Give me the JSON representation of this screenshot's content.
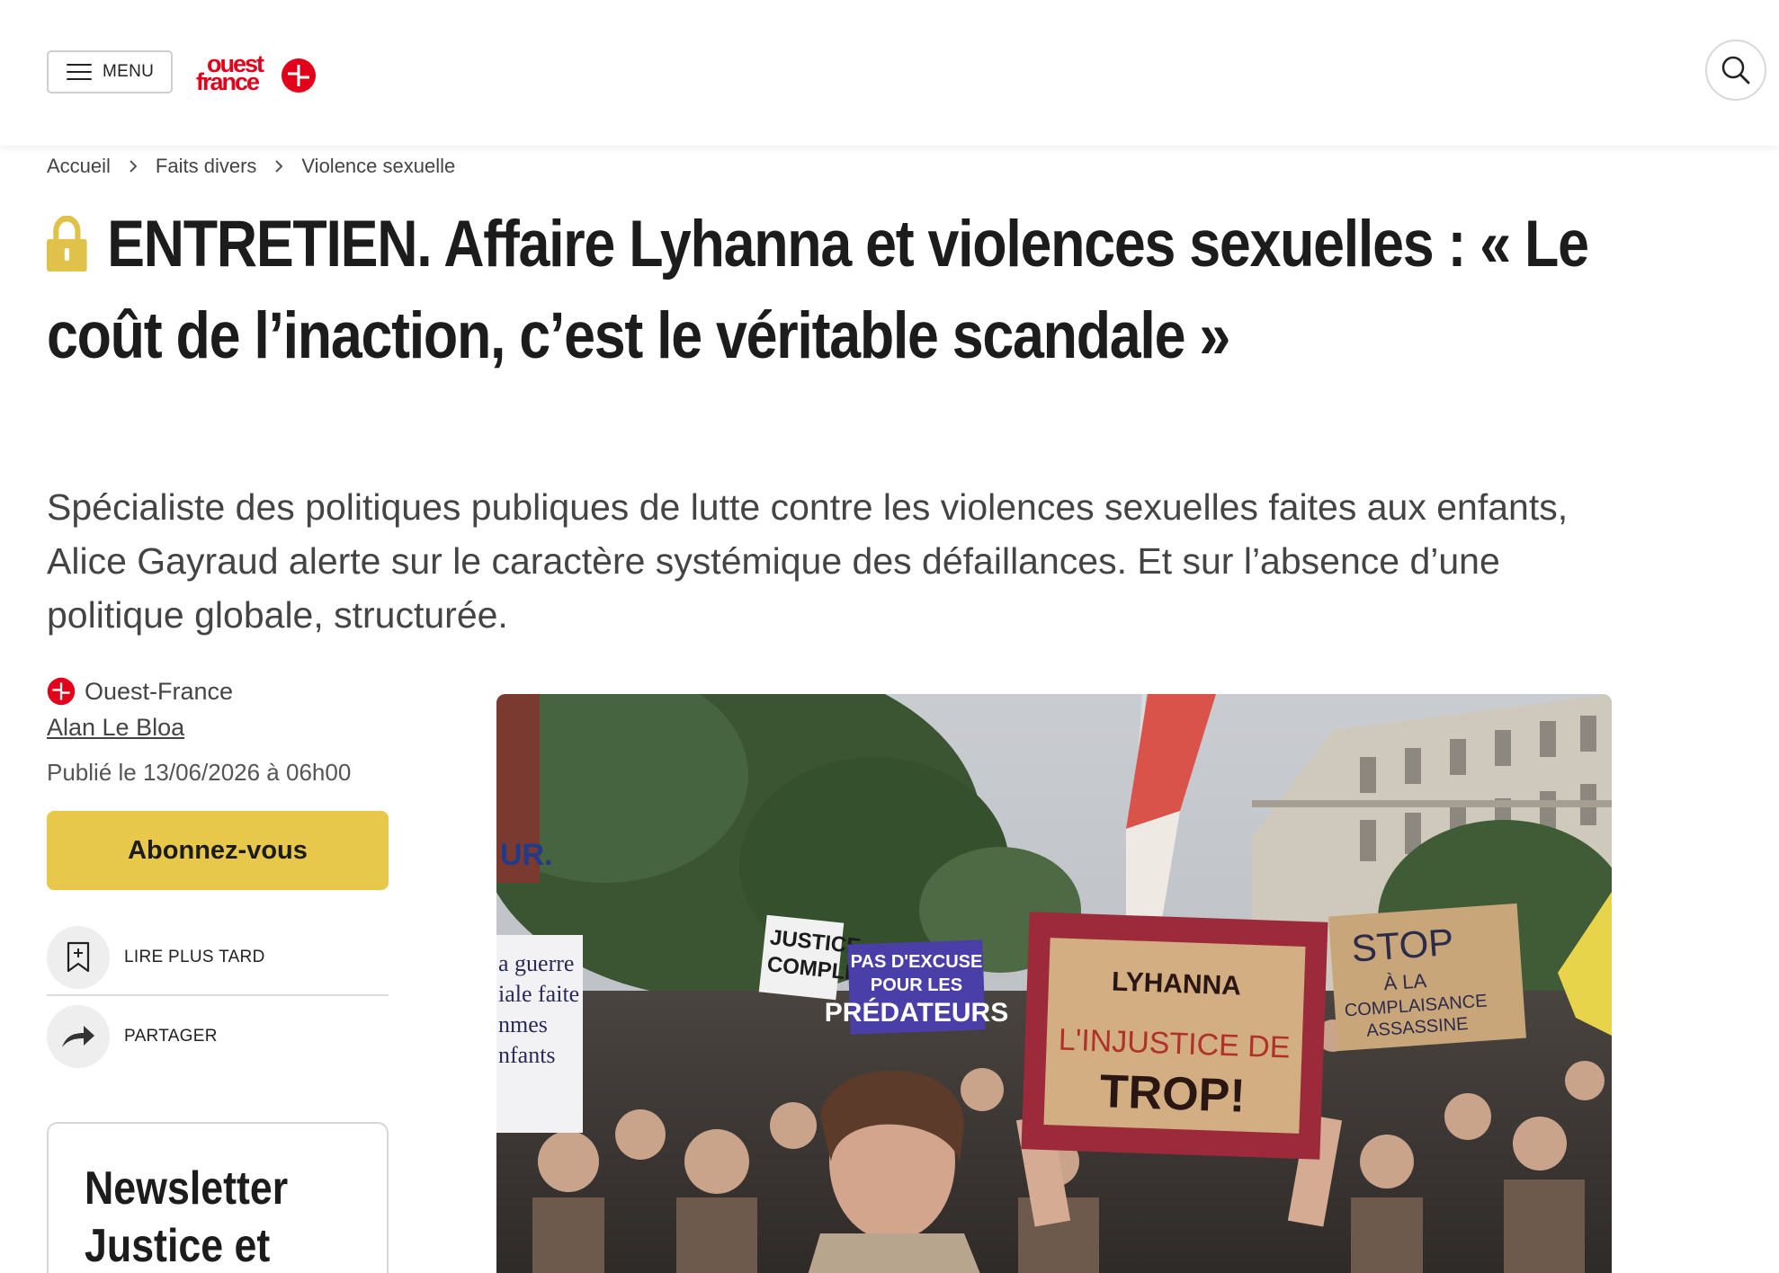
{
  "header": {
    "menu_label": "MENU",
    "logo_line1": "ouest",
    "logo_line2": "france",
    "brand_color": "#e2001a"
  },
  "breadcrumb": [
    "Accueil",
    "Faits divers",
    "Violence sexuelle"
  ],
  "article": {
    "title": "ENTRETIEN. Affaire Lyhanna et violences sexuelles : « Le coût de l’inaction, c’est le véritable scandale »",
    "lead": "Spécialiste des politiques publiques de lutte contre les violences sexuelles faites aux enfants, Alice Gayraud alerte sur le caractère systémique des défaillances. Et sur l’absence d’une politique globale, structurée.",
    "premium_icon": "lock-icon",
    "premium_color": "#e0c24a"
  },
  "meta": {
    "source": "Ouest-France",
    "author": "Alan Le Bloa",
    "published": "Publié le 13/06/2026 à 06h00"
  },
  "actions": {
    "subscribe": "Abonnez-vous",
    "read_later": "LIRE PLUS TARD",
    "share": "PARTAGER",
    "subscribe_color": "#e8c84a"
  },
  "newsletter": {
    "title": "Newsletter Justice et"
  },
  "image": {
    "signs": {
      "left": [
        "a guerre",
        "iale faite",
        "nmes",
        "nfants"
      ],
      "justice": [
        "JUSTICE",
        "COMPLI"
      ],
      "excuse": [
        "PAS D'EXCUSE",
        "POUR LES",
        "PRÉDATEURS"
      ],
      "center": [
        "LYHANNA",
        "L'INJUSTICE DE",
        "TROP!"
      ],
      "stop": [
        "STOP",
        "À LA",
        "COMPLAISANCE",
        "ASSASSINE"
      ],
      "ur": "UR."
    }
  }
}
